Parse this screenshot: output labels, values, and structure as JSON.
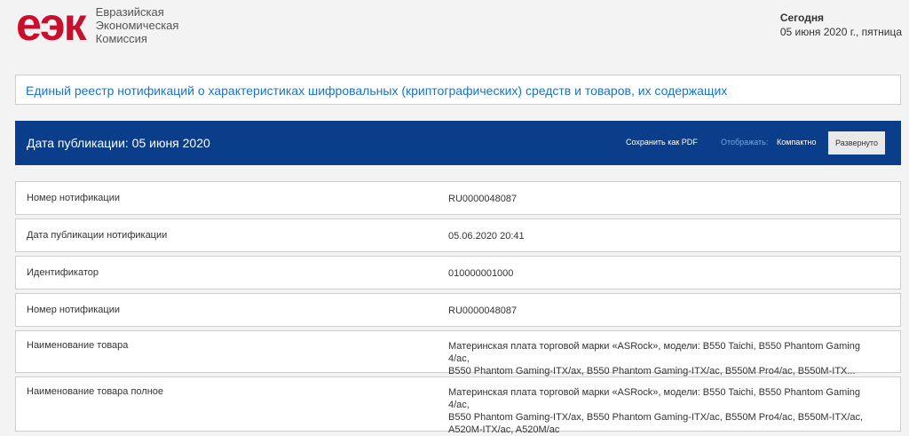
{
  "header": {
    "logo_mark": "еэк",
    "logo_lines": [
      "Евразийская",
      "Экономическая",
      "Комиссия"
    ],
    "today_label": "Сегодня",
    "today_value": "05 июня 2020 г., пятница"
  },
  "registry": {
    "title": "Единый реестр нотификаций о характеристиках шифровальных (криптографических) средств и товаров, их содержащих"
  },
  "publication_bar": {
    "date_text": "Дата публикации: 05 июня 2020",
    "save_pdf": "Сохранить как PDF",
    "display_label": "Отображать:",
    "compact": "Компактно",
    "expanded": "Развернуто"
  },
  "rows": [
    {
      "label": "Номер нотификации",
      "value": "RU0000048087"
    },
    {
      "label": "Дата публикации нотификации",
      "value": "05.06.2020 20:41"
    },
    {
      "label": "Идентификатор",
      "value": "010000001000"
    },
    {
      "label": "Номер нотификации",
      "value": "RU0000048087"
    },
    {
      "label": "Наименование товара",
      "value_lines": [
        "Материнская плата торговой марки «ASRock», модели: B550 Taichi, B550 Phantom Gaming 4/ac,",
        "B550 Phantom Gaming-ITX/ax, B550 Phantom Gaming-ITX/ac, B550M Pro4/ac, B550M-ITX..."
      ]
    },
    {
      "label": "Наименование товара полное",
      "value_lines": [
        "Материнская плата торговой марки «ASRock», модели: B550 Taichi, B550 Phantom Gaming 4/ac,",
        "B550 Phantom Gaming-ITX/ax, B550 Phantom Gaming-ITX/ac, B550M Pro4/ac, B550M-ITX/ac,",
        "A520M-ITX/ac, A520M/ac"
      ]
    }
  ],
  "colors": {
    "brand_red": "#c8102e",
    "bar_blue": "#0a3e8a",
    "link_blue": "#1a73c4"
  }
}
